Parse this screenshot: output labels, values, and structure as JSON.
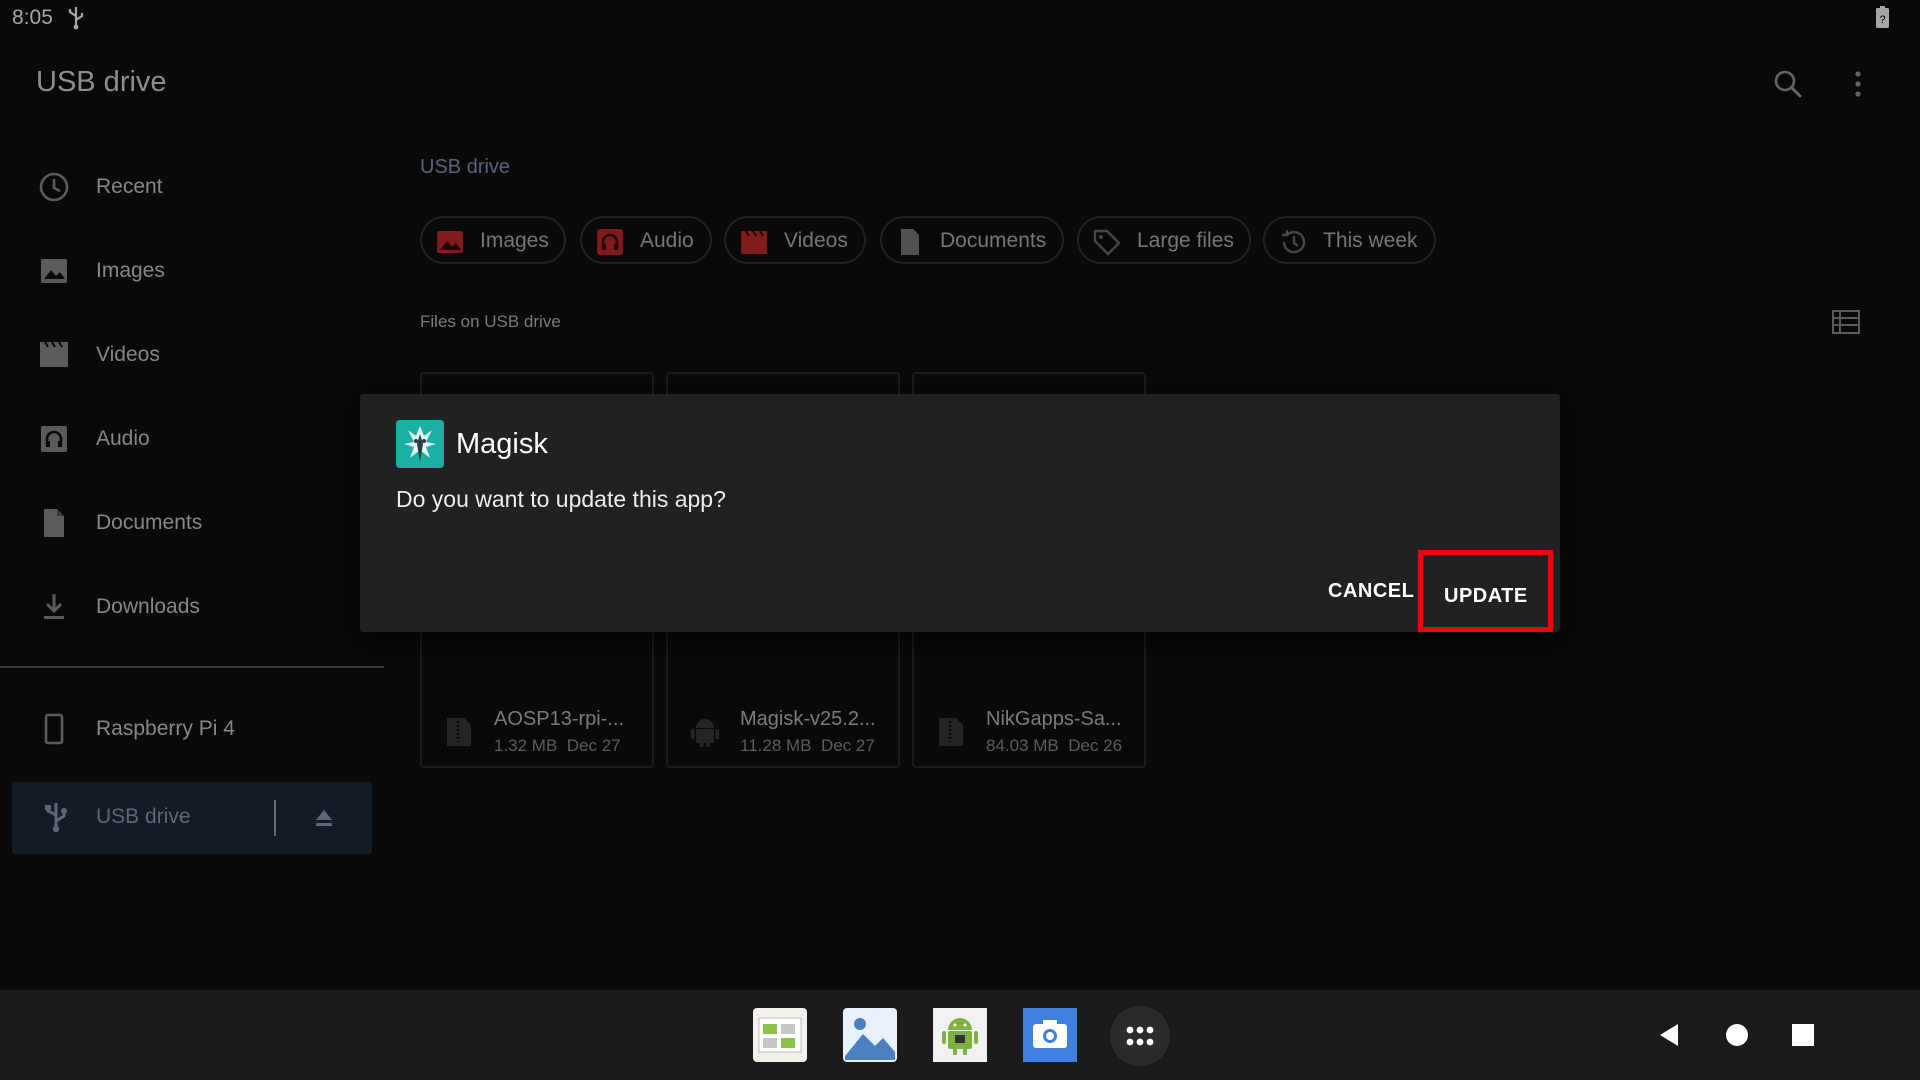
{
  "status": {
    "time": "8:05",
    "usb_icon": "usb-icon",
    "battery_icon": "battery-unknown-icon"
  },
  "appbar": {
    "title": "USB drive",
    "search_icon": "search-icon",
    "menu_icon": "more-vert-icon"
  },
  "drawer": {
    "items": [
      {
        "label": "Recent",
        "icon": "clock-icon"
      },
      {
        "label": "Images",
        "icon": "image-icon"
      },
      {
        "label": "Videos",
        "icon": "video-icon"
      },
      {
        "label": "Audio",
        "icon": "audio-icon"
      },
      {
        "label": "Documents",
        "icon": "document-icon"
      },
      {
        "label": "Downloads",
        "icon": "download-icon"
      }
    ],
    "devices": [
      {
        "label": "Raspberry Pi 4",
        "icon": "phone-icon"
      },
      {
        "label": "USB drive",
        "icon": "usb-icon",
        "selected": true
      }
    ]
  },
  "main": {
    "breadcrumb": "USB drive",
    "chips": [
      "Images",
      "Audio",
      "Videos",
      "Documents",
      "Large files",
      "This week"
    ],
    "section_title": "Files on USB drive",
    "files": [
      {
        "name": "AOSP13-rpi-...",
        "size": "1.32 MB",
        "date": "Dec 27",
        "icon": "zip-icon"
      },
      {
        "name": "Magisk-v25.2...",
        "size": "11.28 MB",
        "date": "Dec 27",
        "icon": "android-icon"
      },
      {
        "name": "NikGapps-Sa...",
        "size": "84.03 MB",
        "date": "Dec 26",
        "icon": "zip-icon"
      }
    ]
  },
  "dialog": {
    "app_name": "Magisk",
    "message": "Do you want to update this app?",
    "cancel_label": "CANCEL",
    "update_label": "UPDATE",
    "highlight_color": "#e30b0b"
  },
  "taskbar": {
    "apps": [
      "store-icon",
      "gallery-icon",
      "android-app-icon",
      "camera-icon",
      "app-drawer-icon"
    ],
    "nav": [
      "back-icon",
      "home-icon",
      "recents-icon"
    ]
  },
  "colors": {
    "background": "#0e0e10",
    "accent": "#7d9bc5",
    "dialog": "#212123"
  }
}
